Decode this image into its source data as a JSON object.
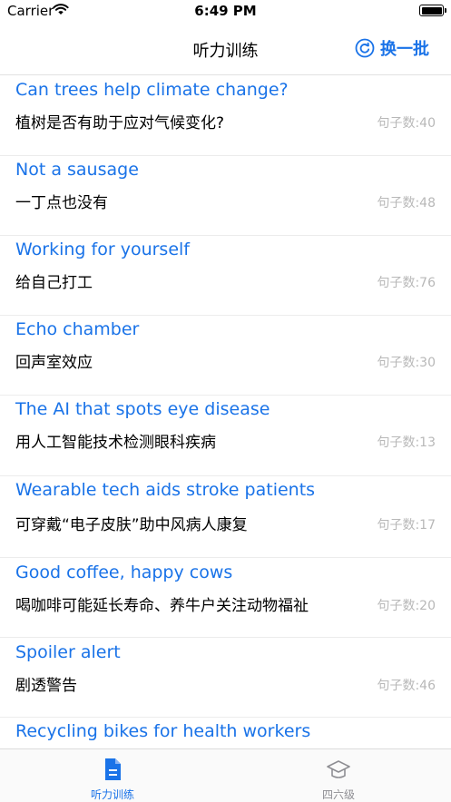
{
  "status_bar": {
    "carrier": "Carrier",
    "time": "6:49 PM"
  },
  "nav": {
    "title": "听力训练",
    "refresh_label": "换一批"
  },
  "articles": [
    {
      "title": "Can trees help climate change?",
      "subtitle": "植树是否有助于应对气候变化?",
      "count": "句子数:40"
    },
    {
      "title": "Not a sausage",
      "subtitle": "一丁点也没有",
      "count": "句子数:48"
    },
    {
      "title": "Working for yourself",
      "subtitle": "给自己打工",
      "count": "句子数:76"
    },
    {
      "title": "Echo chamber",
      "subtitle": "回声室效应",
      "count": "句子数:30"
    },
    {
      "title": "The AI that spots eye disease",
      "subtitle": "用人工智能技术检测眼科疾病",
      "count": "句子数:13"
    },
    {
      "title": "Wearable tech aids stroke patients",
      "subtitle": "可穿戴“电子皮肤”助中风病人康复",
      "count": "句子数:17"
    },
    {
      "title": "Good coffee, happy cows",
      "subtitle": "喝咖啡可能延长寿命、养牛户关注动物福祉",
      "count": "句子数:20"
    },
    {
      "title": " Spoiler alert",
      "subtitle": "剧透警告",
      "count": "句子数:46"
    },
    {
      "title": "Recycling bikes for health workers",
      "subtitle": "",
      "count": ""
    }
  ],
  "tabs": [
    {
      "label": "听力训练",
      "icon": "document-icon",
      "active": true
    },
    {
      "label": "四六级",
      "icon": "graduation-cap-icon",
      "active": false
    }
  ],
  "colors": {
    "accent": "#1a73e8",
    "inactive": "#8e8e93",
    "count": "#b8b8b8"
  }
}
